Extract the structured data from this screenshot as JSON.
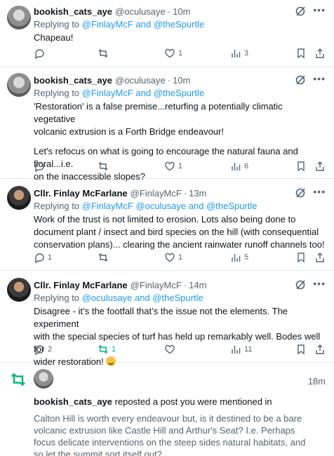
{
  "posts": [
    {
      "name": "bookish_cats_aye",
      "handle": "@oculusaye",
      "time": "10m",
      "replying_prefix": "Replying to ",
      "replying_to": "@FinlayMcF and @theSpurtle",
      "text": [
        "Chapeau!"
      ],
      "replies": "",
      "reposts": "",
      "likes": "1",
      "views": "3"
    },
    {
      "name": "bookish_cats_aye",
      "handle": "@oculusaye",
      "time": "10m",
      "replying_prefix": "Replying to ",
      "replying_to": "@FinlayMcF and @theSpurtle",
      "text": [
        "'Restoration' is a false premise...returfing a potentially climatic vegetative",
        "volcanic extrusion is a Forth Bridge endeavour!",
        "",
        "Let's refocus on what is going to encourage the natural fauna and floral...i.e.",
        "on the inaccessible slopes?"
      ],
      "replies": "",
      "reposts": "",
      "likes": "1",
      "views": "6"
    },
    {
      "name": "Cllr. Finlay McFarlane",
      "handle": "@FinlayMcF",
      "time": "13m",
      "replying_prefix": "Replying to ",
      "replying_to": "@FinlayMcF @oculusaye and @theSpurtle",
      "text": [
        "Work of the trust is not limited to erosion. Lots also being done to",
        "document plant / insect and bird species on the hill (with consequential",
        "conservation plans)... clearing the ancient rainwater runoff channels too!"
      ],
      "replies": "1",
      "reposts": "",
      "likes": "1",
      "views": "5"
    },
    {
      "name": "Cllr. Finlay McFarlane",
      "handle": "@FinlayMcF",
      "time": "14m",
      "replying_prefix": "Replying to ",
      "replying_to": "@oculusaye and @theSpurtle",
      "text": [
        "Disagree - it’s the footfall that’s the issue not the elements. The experiment",
        "with the special species of turf has held up remarkably well. Bodes well for",
        "wider restoration! "
      ],
      "replies": "2",
      "reposts": "1",
      "likes": "",
      "views": "11"
    }
  ],
  "notification": {
    "time": "18m",
    "user": "bookish_cats_aye",
    "action": " reposted a post you were mentioned in",
    "text": [
      "Calton Hill is worth every endeavour but, is it destined to be a bare",
      "volcanic extrusion like Castle Hill and Arthur's Seat? I.e. Perhaps",
      "focus delicate interventions on the steep sides natural habitats, and",
      "so let the summit sort itself out?"
    ]
  },
  "icons": {
    "reply": "speech-bubble-icon",
    "repost": "repost-arrows-icon",
    "like": "heart-icon",
    "views": "bar-chart-icon",
    "bookmark": "bookmark-icon",
    "share": "share-upload-icon",
    "grok": "grok-slash-icon",
    "more": "more-dots-icon",
    "emoji": "slightly-smiling-face-emoji"
  },
  "colors": {
    "link": "#1d9bf0",
    "muted": "#536471",
    "repost_green": "#00ba7c",
    "divider": "#e7e9ea"
  }
}
